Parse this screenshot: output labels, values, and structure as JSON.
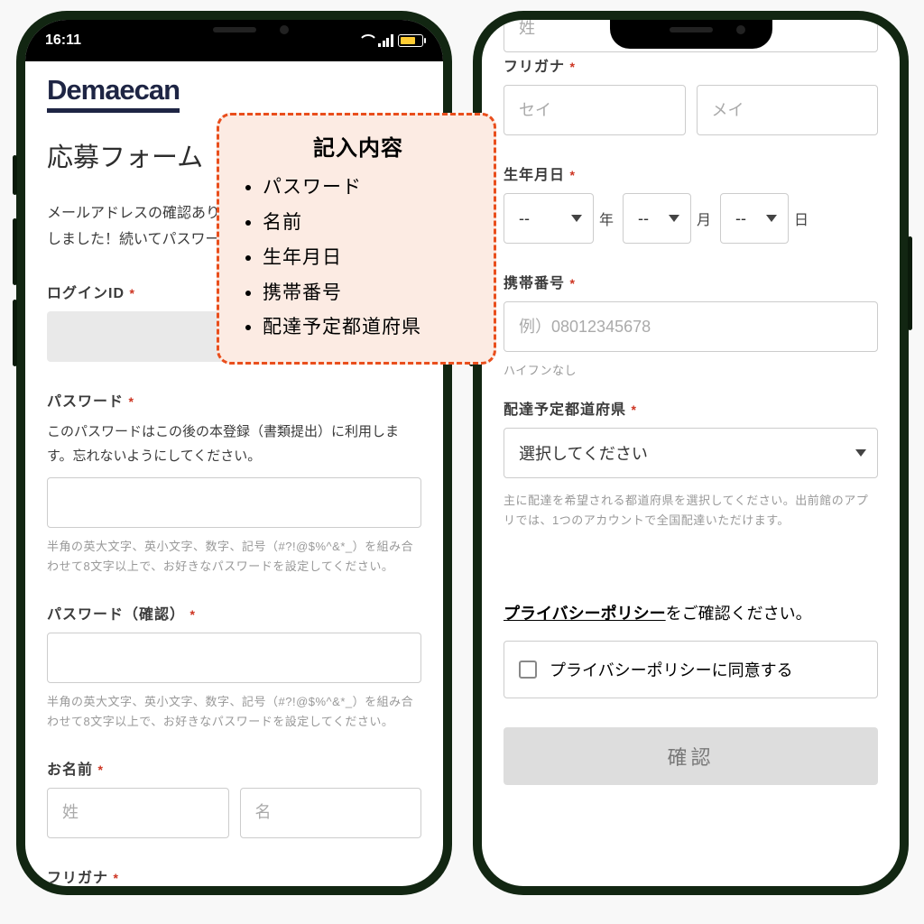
{
  "statusbar": {
    "time": "16:11"
  },
  "brand": "Demaecan",
  "page_title": "応募フォーム",
  "intro_text": "メールアドレスの確認ありがとうございます。応募が完了しました！続いてパスワードを設定してください。",
  "login_id": {
    "label": "ログインID"
  },
  "password": {
    "label": "パスワード",
    "desc": "このパスワードはこの後の本登録（書類提出）に利用します。忘れないようにしてください。",
    "help": "半角の英大文字、英小文字、数字、記号（#?!@$%^&*_）を組み合わせて8文字以上で、お好きなパスワードを設定してください。"
  },
  "password_confirm": {
    "label": "パスワード（確認）",
    "help": "半角の英大文字、英小文字、数字、記号（#?!@$%^&*_）を組み合わせて8文字以上で、お好きなパスワードを設定してください。"
  },
  "name": {
    "label": "お名前",
    "last_ph": "姓",
    "first_ph": "名"
  },
  "furigana": {
    "label": "フリガナ",
    "sei_ph": "セイ",
    "mei_ph": "メイ"
  },
  "dob": {
    "label": "生年月日",
    "placeholder": "--",
    "unit_year": "年",
    "unit_month": "月",
    "unit_day": "日"
  },
  "phone": {
    "label": "携帯番号",
    "placeholder": "例）08012345678",
    "help": "ハイフンなし"
  },
  "prefecture": {
    "label": "配達予定都道府県",
    "placeholder": "選択してください",
    "help": "主に配達を希望される都道府県を選択してください。出前館のアプリでは、1つのアカウントで全国配達いただけます。"
  },
  "privacy": {
    "link_text": "プライバシーポリシー",
    "suffix": "をご確認ください。",
    "checkbox_label": "プライバシーポリシーに同意する"
  },
  "confirm_label": "確認",
  "callout": {
    "title": "記入内容",
    "items": [
      "パスワード",
      "名前",
      "生年月日",
      "携帯番号",
      "配達予定都道府県"
    ]
  },
  "req_mark": "*"
}
